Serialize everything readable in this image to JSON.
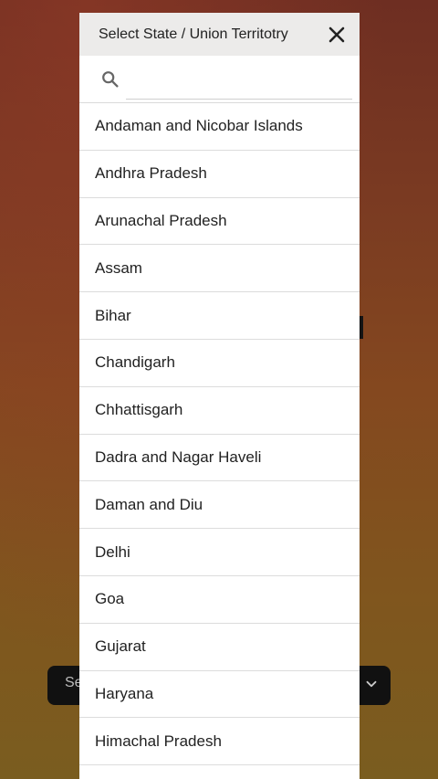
{
  "background": {
    "bottom_bar_text": "Se"
  },
  "modal": {
    "title": "Select State / Union Territotry",
    "search": {
      "value": "",
      "placeholder": ""
    },
    "states": [
      "Andaman and Nicobar Islands",
      "Andhra Pradesh",
      "Arunachal Pradesh",
      "Assam",
      "Bihar",
      "Chandigarh",
      "Chhattisgarh",
      "Dadra and Nagar Haveli",
      "Daman and Diu",
      "Delhi",
      "Goa",
      "Gujarat",
      "Haryana",
      "Himachal Pradesh"
    ]
  },
  "colors": {
    "header_bg": "#ecebea",
    "divider": "#dcdcdc"
  }
}
